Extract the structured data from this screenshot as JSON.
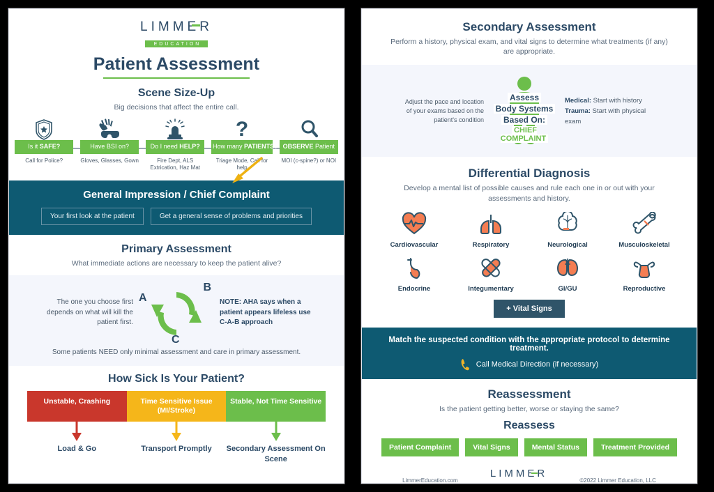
{
  "brand": {
    "logo_word": "LIMMER",
    "logo_sub": "EDUCATION"
  },
  "left": {
    "title": "Patient Assessment",
    "scene": {
      "heading": "Scene Size-Up",
      "subtitle": "Big decisions that affect the entire call.",
      "nodes": [
        {
          "icon": "police-badge-icon",
          "badge_plain": "Is it ",
          "badge_bold": "SAFE?",
          "badge_tail": "",
          "caption": "Call for Police?"
        },
        {
          "icon": "gloves-goggles-icon",
          "badge_plain": "Have BSI on?",
          "badge_bold": "",
          "badge_tail": "",
          "caption": "Gloves, Glasses, Gown"
        },
        {
          "icon": "siren-icon",
          "badge_plain": "Do I need ",
          "badge_bold": "HELP?",
          "badge_tail": "",
          "caption": "Fire Dept, ALS Extrication, Haz Mat"
        },
        {
          "icon": "question-mark-icon",
          "badge_plain": "How many ",
          "badge_bold": "PATIENTS?",
          "badge_tail": "",
          "caption": "Triage Mode, Call for help"
        },
        {
          "icon": "magnifying-glass-icon",
          "badge_plain": "",
          "badge_bold": "OBSERVE",
          "badge_tail": " Patient",
          "caption": "MOI (c-spine?) or NOI"
        }
      ]
    },
    "impression": {
      "title": "General Impression / Chief Complaint",
      "chips": [
        "Your first look at the patient",
        "Get a general sense of problems and priorities"
      ]
    },
    "primary": {
      "heading": "Primary Assessment",
      "subtitle": "What immediate actions are necessary to keep the patient alive?",
      "left_text": "The one you choose first depends on what will kill the patient first.",
      "letter_a": "A",
      "letter_b": "B",
      "letter_c": "C",
      "right_text": "NOTE: AHA says when a patient appears lifeless use C-A-B approach",
      "note": "Some patients NEED only minimal assessment and care in primary assessment."
    },
    "severity": {
      "heading": "How Sick Is Your Patient?",
      "items": [
        {
          "bar": "Unstable, Crashing",
          "color": "#c9372c",
          "outcome": "Load & Go"
        },
        {
          "bar": "Time Sensitive Issue (MI/Stroke)",
          "color": "#f5b61a",
          "outcome": "Transport Promptly"
        },
        {
          "bar": "Stable, Not Time Sensitive",
          "color": "#6cbe4b",
          "outcome": "Secondary Assessment On Scene"
        }
      ]
    }
  },
  "right": {
    "secondary": {
      "heading": "Secondary Assessment",
      "subtitle": "Perform a history, physical exam, and vital signs to determine what treatments (if any) are appropriate.",
      "left_text": "Adjust the pace and location of your exams based on the patient's condition",
      "overlay_1": "Assess",
      "overlay_2": "Body Systems",
      "overlay_3": "Based On:",
      "overlay_4": "CHIEF COMPLAINT",
      "right_medical_label": "Medical:",
      "right_medical_text": " Start with history",
      "right_trauma_label": "Trauma:",
      "right_trauma_text": " Start with physical exam"
    },
    "differential": {
      "heading": "Differential Diagnosis",
      "subtitle": "Develop a mental list of possible causes and rule each one in or out with your assessments and history.",
      "items": [
        {
          "icon": "heart-icon",
          "label": "Cardiovascular"
        },
        {
          "icon": "lungs-icon",
          "label": "Respiratory"
        },
        {
          "icon": "brain-icon",
          "label": "Neurological"
        },
        {
          "icon": "bone-icon",
          "label": "Musculoskeletal"
        },
        {
          "icon": "stomach-icon",
          "label": "Endocrine"
        },
        {
          "icon": "bandage-icon",
          "label": "Integumentary"
        },
        {
          "icon": "kidneys-icon",
          "label": "GI/GU"
        },
        {
          "icon": "uterus-icon",
          "label": "Reproductive"
        }
      ],
      "vital_button": "+ Vital Signs"
    },
    "protocol": {
      "line1": "Match the suspected condition with the appropriate protocol to determine treatment.",
      "line2": "Call Medical Direction (if necessary)",
      "phone_icon": "phone-icon"
    },
    "reassessment": {
      "heading": "Reassessment",
      "subtitle": "Is the patient getting better, worse or staying the same?",
      "reassess_heading": "Reassess",
      "buttons": [
        "Patient Complaint",
        "Vital Signs",
        "Mental Status",
        "Treatment Provided"
      ]
    },
    "footer": {
      "website": "LimmerEducation.com",
      "copyright": "©2022 Limmer Education, LLC"
    }
  },
  "colors": {
    "green": "#6cbe4b",
    "teal": "#0e5a72",
    "navy": "#2c4a66",
    "amber": "#eeb111",
    "red": "#c9372c",
    "tint": "#f4f6fc"
  }
}
